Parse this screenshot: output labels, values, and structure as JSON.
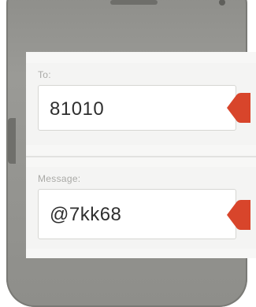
{
  "compose": {
    "to_label": "To:",
    "to_value": "81010",
    "message_label": "Message:",
    "message_value": "@7kk68"
  },
  "colors": {
    "accent": "#d8452b",
    "phone_frame": "#8f8f8b",
    "field_text": "#2f2f2f",
    "label_text": "#a9a9a6"
  },
  "icons": [
    "speaker-grille",
    "front-camera",
    "pointer-arrow-icon"
  ]
}
